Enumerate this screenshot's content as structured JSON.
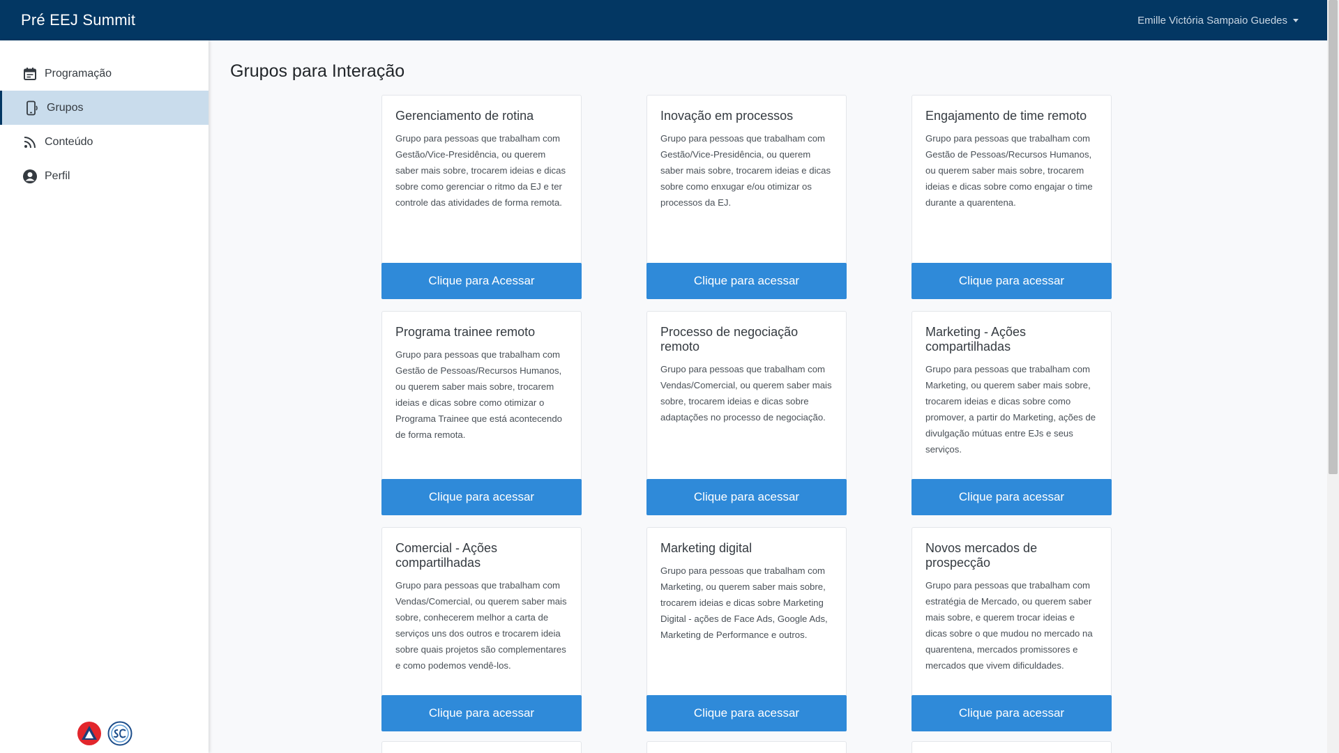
{
  "header": {
    "brand": "Pré EEJ Summit",
    "user_name": "Emille Victória Sampaio Guedes"
  },
  "sidebar": {
    "items": [
      {
        "label": "Programação",
        "icon": "calendar-icon"
      },
      {
        "label": "Grupos",
        "icon": "phone-ring-icon",
        "active": true
      },
      {
        "label": "Conteúdo",
        "icon": "rss-icon"
      },
      {
        "label": "Perfil",
        "icon": "user-circle-icon"
      }
    ]
  },
  "main": {
    "title": "Grupos para Interação",
    "cards": [
      {
        "title": "Gerenciamento de rotina",
        "text": "Grupo para pessoas que trabalham com Gestão/Vice-Presidência, ou querem saber mais sobre, trocarem ideias e dicas sobre como gerenciar o ritmo da EJ e ter controle das atividades de forma remota.",
        "button": "Clique para Acessar"
      },
      {
        "title": "Inovação em processos",
        "text": "Grupo para pessoas que trabalham com Gestão/Vice-Presidência, ou querem saber mais sobre, trocarem ideias e dicas sobre como enxugar e/ou otimizar os processos da EJ.",
        "button": "Clique para acessar"
      },
      {
        "title": "Engajamento de time remoto",
        "text": "Grupo para pessoas que trabalham com Gestão de Pessoas/Recursos Humanos, ou querem saber mais sobre, trocarem ideias e dicas sobre como engajar o time durante a quarentena.",
        "button": "Clique para acessar"
      },
      {
        "title": "Programa trainee remoto",
        "text": "Grupo para pessoas que trabalham com Gestão de Pessoas/Recursos Humanos, ou querem saber mais sobre, trocarem ideias e dicas sobre como otimizar o Programa Trainee que está acontecendo de forma remota.",
        "button": "Clique para acessar"
      },
      {
        "title": "Processo de negociação remoto",
        "text": "Grupo para pessoas que trabalham com Vendas/Comercial, ou querem saber mais sobre, trocarem ideias e dicas sobre adaptações no processo de negociação.",
        "button": "Clique para acessar"
      },
      {
        "title": "Marketing - Ações compartilhadas",
        "text": "Grupo para pessoas que trabalham com Marketing, ou querem saber mais sobre, trocarem ideias e dicas sobre como promover, a partir do Marketing, ações de divulgação mútuas entre EJs e seus serviços.",
        "button": "Clique para acessar"
      },
      {
        "title": "Comercial - Ações compartilhadas",
        "text": "Grupo para pessoas que trabalham com Vendas/Comercial, ou querem saber mais sobre, conhecerem melhor a carta de serviços uns dos outros e trocarem ideia sobre quais projetos são complementares e como podemos vendê-los.",
        "button": "Clique para acessar"
      },
      {
        "title": "Marketing digital",
        "text": "Grupo para pessoas que trabalham com Marketing, ou querem saber mais sobre, trocarem ideias e dicas sobre Marketing Digital - ações de Face Ads, Google Ads, Marketing de Performance e outros.",
        "button": "Clique para acessar"
      },
      {
        "title": "Novos mercados de prospecção",
        "text": "Grupo para pessoas que trabalham com estratégia de Mercado, ou querem saber mais sobre, e querem trocar ideias e dicas sobre o que mudou no mercado na quarentena, mercados promissores e mercados que vivem dificuldades.",
        "button": "Clique para acessar"
      }
    ]
  },
  "colors": {
    "topbar": "#033763",
    "accent": "#2f8ad9",
    "active_nav": "#c9dcec"
  }
}
